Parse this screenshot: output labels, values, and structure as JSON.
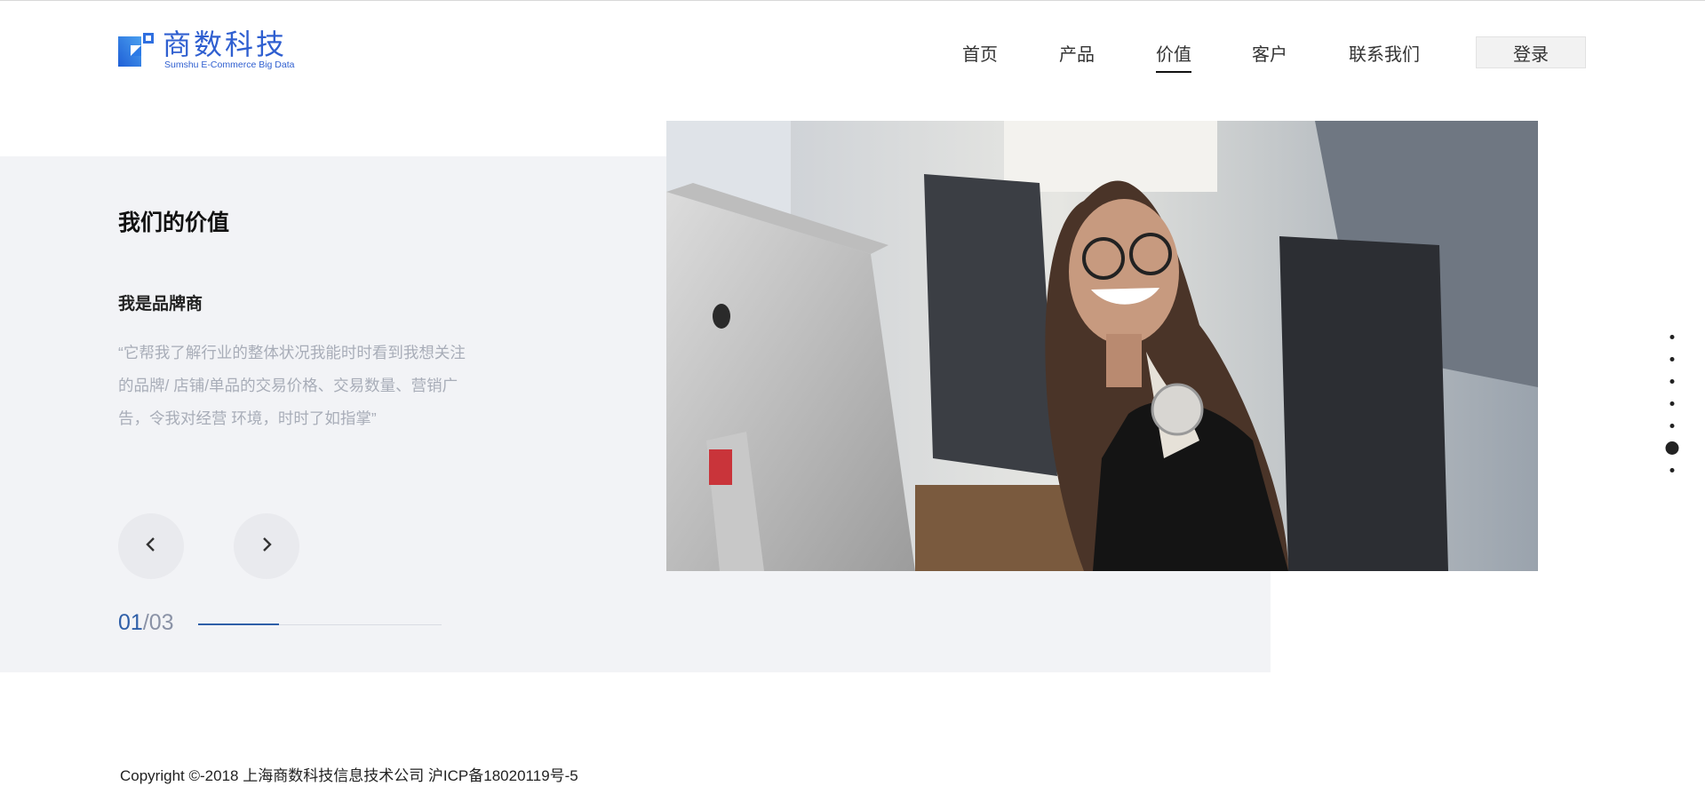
{
  "header": {
    "logo": {
      "cn": "商数科技",
      "en": "Sumshu E-Commerce Big Data"
    },
    "nav": [
      {
        "label": "首页",
        "active": false
      },
      {
        "label": "产品",
        "active": false
      },
      {
        "label": "价值",
        "active": true
      },
      {
        "label": "客户",
        "active": false
      },
      {
        "label": "联系我们",
        "active": false
      }
    ],
    "login_label": "登录"
  },
  "value_section": {
    "title": "我们的价值",
    "role": "我是品牌商",
    "quote": "“它帮我了解行业的整体状况我能时时看到我想关注的品牌/ 店铺/单品的交易价格、交易数量、营销广告，令我对经营 环境，时时了如指掌”",
    "slide_current": "01",
    "slide_separator": "/",
    "slide_total": "03",
    "progress_fraction": 0.333,
    "prev_icon": "chevron-left-icon",
    "next_icon": "chevron-right-icon"
  },
  "photo": {
    "subject": "woman-at-desk-photo"
  },
  "side_nav": {
    "count": 7,
    "active_index": 5
  },
  "footer": {
    "copyright": "Copyright ©-2018 上海商数科技信息技术公司 沪ICP备18020119号-5"
  },
  "colors": {
    "brand": "#2f5fd0",
    "accent": "#2f5fa8",
    "panel": "#f2f3f6"
  }
}
